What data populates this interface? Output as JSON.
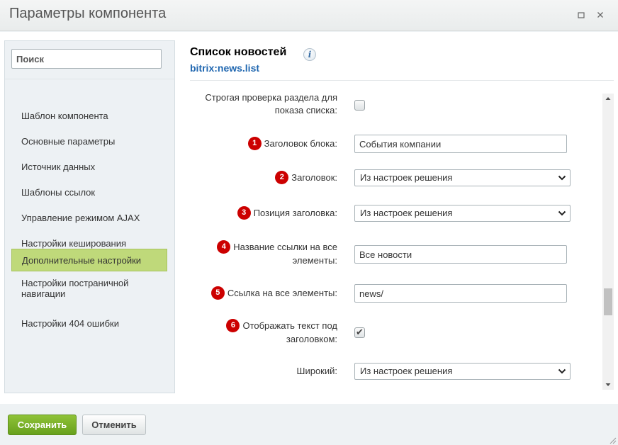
{
  "window": {
    "title": "Параметры компонента"
  },
  "sidebar": {
    "search_placeholder": "Поиск",
    "items": [
      {
        "label": "Шаблон компонента"
      },
      {
        "label": "Основные параметры"
      },
      {
        "label": "Источник данных"
      },
      {
        "label": "Шаблоны ссылок"
      },
      {
        "label": "Управление режимом AJAX"
      },
      {
        "label": "Настройки кеширования"
      },
      {
        "label": "Дополнительные настройки",
        "active": true
      },
      {
        "label": "Настройки постраничной навигации"
      },
      {
        "label": "Настройки 404 ошибки"
      }
    ]
  },
  "component": {
    "title": "Список новостей",
    "code": "bitrix:news.list"
  },
  "fields": {
    "strict_check": {
      "label": "Строгая проверка раздела для показа списка:",
      "checked": false
    },
    "block_title": {
      "badge": "1",
      "label": "Заголовок блока:",
      "value": "События компании"
    },
    "title": {
      "badge": "2",
      "label": "Заголовок:",
      "value": "Из настроек решения"
    },
    "title_position": {
      "badge": "3",
      "label": "Позиция заголовка:",
      "value": "Из настроек решения"
    },
    "all_link_name": {
      "badge": "4",
      "label": "Название ссылки на все элементы:",
      "value": "Все новости"
    },
    "all_link_url": {
      "badge": "5",
      "label": "Ссылка на все элементы:",
      "value": "news/"
    },
    "show_text_under_title": {
      "badge": "6",
      "label": "Отображать текст под заголовком:",
      "checked": true
    },
    "wide": {
      "label": "Широкий:",
      "value": "Из настроек решения"
    }
  },
  "footer": {
    "save_label": "Сохранить",
    "cancel_label": "Отменить"
  },
  "colors": {
    "accent_green": "#7ab32c",
    "active_item": "#bfd97a",
    "badge_red": "#cc0000",
    "link_blue": "#2067b0"
  }
}
